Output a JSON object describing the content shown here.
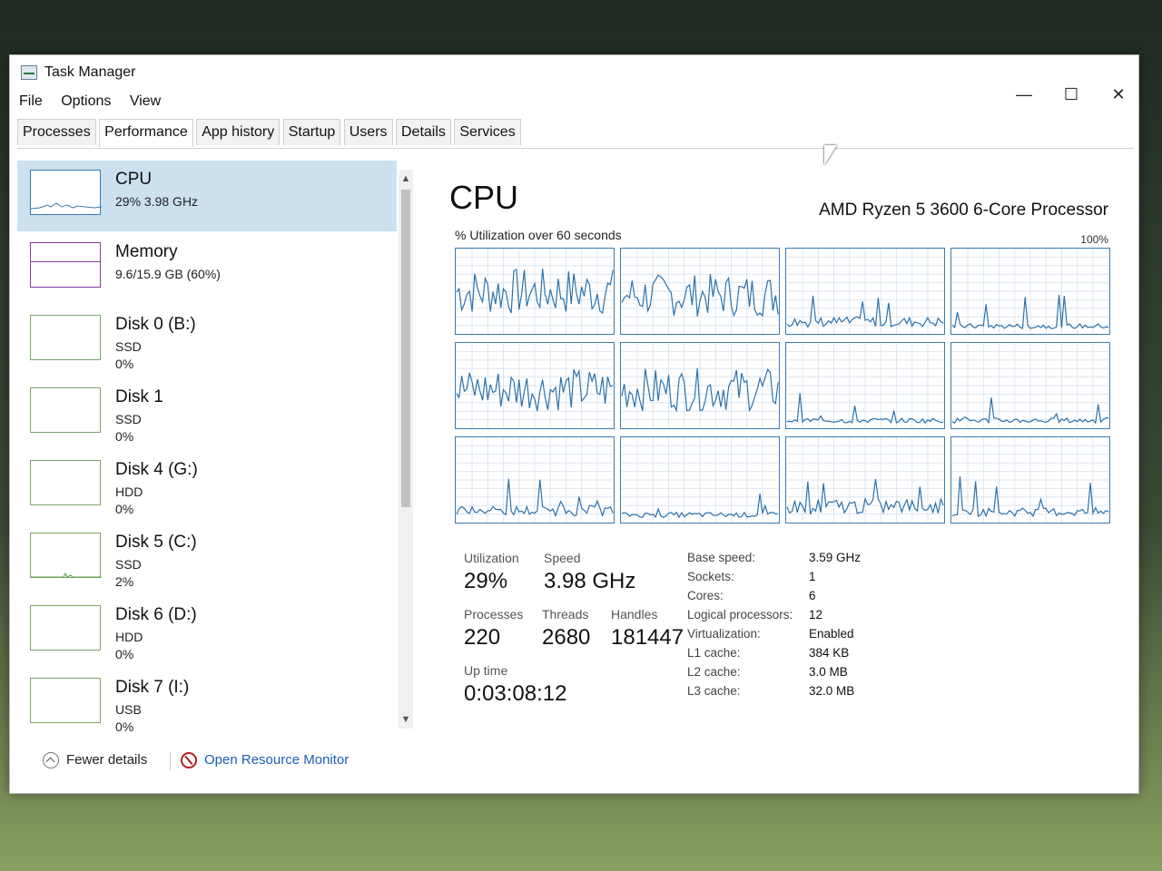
{
  "window": {
    "title": "Task Manager"
  },
  "window_controls": {
    "minimize": "—",
    "maximize": "☐",
    "close": "✕"
  },
  "menu": [
    "File",
    "Options",
    "View"
  ],
  "tabs": [
    {
      "label": "Processes",
      "active": false
    },
    {
      "label": "Performance",
      "active": true
    },
    {
      "label": "App history",
      "active": false
    },
    {
      "label": "Startup",
      "active": false
    },
    {
      "label": "Users",
      "active": false
    },
    {
      "label": "Details",
      "active": false
    },
    {
      "label": "Services",
      "active": false
    }
  ],
  "sidebar": {
    "items": [
      {
        "title": "CPU",
        "sub1": "29%  3.98 GHz",
        "sub2": "",
        "selected": true,
        "kind": "cpu"
      },
      {
        "title": "Memory",
        "sub1": "9.6/15.9 GB (60%)",
        "sub2": "",
        "selected": false,
        "kind": "mem"
      },
      {
        "title": "Disk 0 (B:)",
        "sub1": "SSD",
        "sub2": "0%",
        "selected": false,
        "kind": "disk"
      },
      {
        "title": "Disk 1",
        "sub1": "SSD",
        "sub2": "0%",
        "selected": false,
        "kind": "disk"
      },
      {
        "title": "Disk 4 (G:)",
        "sub1": "HDD",
        "sub2": "0%",
        "selected": false,
        "kind": "disk"
      },
      {
        "title": "Disk 5 (C:)",
        "sub1": "SSD",
        "sub2": "2%",
        "selected": false,
        "kind": "disk"
      },
      {
        "title": "Disk 6 (D:)",
        "sub1": "HDD",
        "sub2": "0%",
        "selected": false,
        "kind": "disk"
      },
      {
        "title": "Disk 7 (I:)",
        "sub1": "USB",
        "sub2": "0%",
        "selected": false,
        "kind": "disk"
      }
    ]
  },
  "footer": {
    "fewer_details": "Fewer details",
    "resource_monitor": "Open Resource Monitor"
  },
  "main": {
    "title": "CPU",
    "processor": "AMD Ryzen 5 3600 6-Core Processor",
    "util_label": "% Utilization over 60 seconds",
    "max_label": "100%",
    "core_levels": [
      0.55,
      0.5,
      0.12,
      0.06,
      0.5,
      0.5,
      0.06,
      0.06,
      0.12,
      0.06,
      0.18,
      0.1
    ]
  },
  "stats": {
    "utilization_label": "Utilization",
    "utilization": "29%",
    "speed_label": "Speed",
    "speed": "3.98 GHz",
    "processes_label": "Processes",
    "processes": "220",
    "threads_label": "Threads",
    "threads": "2680",
    "handles_label": "Handles",
    "handles": "181447",
    "uptime_label": "Up time",
    "uptime": "0:03:08:12"
  },
  "specs": [
    {
      "label": "Base speed:",
      "value": "3.59 GHz"
    },
    {
      "label": "Sockets:",
      "value": "1"
    },
    {
      "label": "Cores:",
      "value": "6"
    },
    {
      "label": "Logical processors:",
      "value": "12"
    },
    {
      "label": "Virtualization:",
      "value": "Enabled"
    },
    {
      "label": "L1 cache:",
      "value": "384 KB"
    },
    {
      "label": "L2 cache:",
      "value": "3.0 MB"
    },
    {
      "label": "L3 cache:",
      "value": "32.0 MB"
    }
  ]
}
